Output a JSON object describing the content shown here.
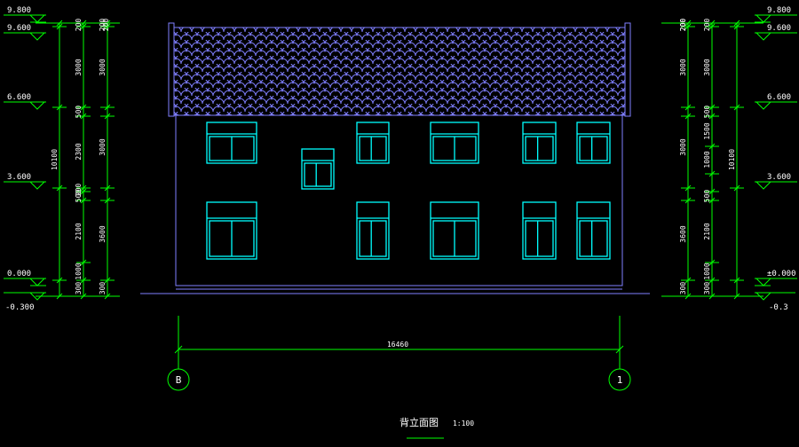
{
  "left_levels": [
    "9.800",
    "9.600",
    "6.600",
    "3.600",
    "0.000",
    "-0.300"
  ],
  "right_levels": [
    "9.800",
    "9.600",
    "6.600",
    "3.600",
    "±0.000",
    "-0.3"
  ],
  "left_inner_dims": [
    "200",
    "3000",
    "500",
    "2300",
    "200",
    "500",
    "2100",
    "1000",
    "300"
  ],
  "left_outer_dims": [
    "200",
    "3000",
    "3000",
    "3600",
    "300"
  ],
  "right_inner_dims": [
    "200",
    "3000",
    "500",
    "1500",
    "1000",
    "500",
    "2100",
    "1000",
    "300"
  ],
  "right_outer_dims": [
    "200",
    "3000",
    "3000",
    "3600",
    "300"
  ],
  "total_height_left": "10100",
  "total_height_right": "10100",
  "horizontal_dim": "16460",
  "axis_left": "B",
  "axis_right": "1",
  "title": "背立面图",
  "scale": "1:100",
  "colors": {
    "background": "#000000",
    "dimension": "#00ff00",
    "text": "#ffffff",
    "window": "#00ffff",
    "roof": "#8080ff",
    "wall": "#8080ff"
  }
}
